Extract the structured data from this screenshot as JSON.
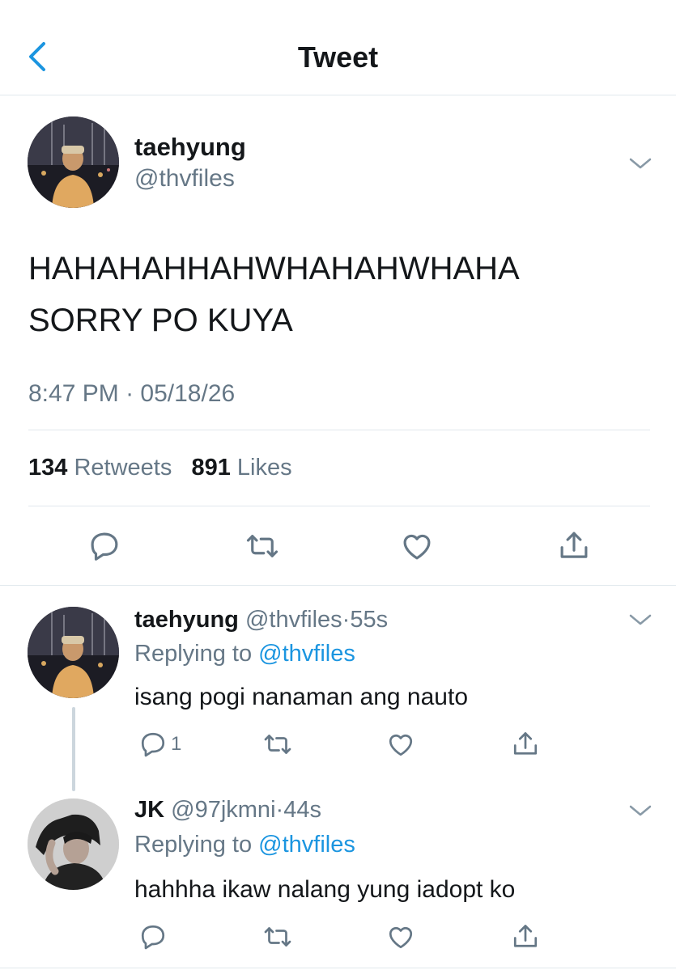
{
  "header": {
    "title": "Tweet",
    "back_icon": "chevron-left-icon"
  },
  "tweet": {
    "author_name": "taehyung",
    "author_handle": "@thvfiles",
    "text": "HAHAHAHHAHWHAHAHWHAHA\nSORRY PO KUYA",
    "time": "8:47 PM",
    "sep": "·",
    "date": "05/18/26",
    "retweets_count": "134",
    "retweets_label": "Retweets",
    "likes_count": "891",
    "likes_label": "Likes"
  },
  "replies": [
    {
      "name": "taehyung",
      "handle": "@thvfiles",
      "age": "55s",
      "replying_prefix": "Replying to",
      "replying_to": "@thvfiles",
      "text": "isang pogi nanaman ang nauto",
      "reply_count": "1"
    },
    {
      "name": "JK",
      "handle": "@97jkmni",
      "age": "44s",
      "replying_prefix": "Replying to",
      "replying_to": "@thvfiles",
      "text": "hahhha ikaw nalang yung iadopt ko",
      "reply_count": ""
    }
  ],
  "colors": {
    "accent": "#1b95e0",
    "muted": "#657786",
    "divider": "#e1e8ed",
    "text": "#14171a"
  },
  "icons": [
    "chevron-left-icon",
    "chevron-down-icon",
    "reply-icon",
    "retweet-icon",
    "heart-icon",
    "share-icon"
  ]
}
